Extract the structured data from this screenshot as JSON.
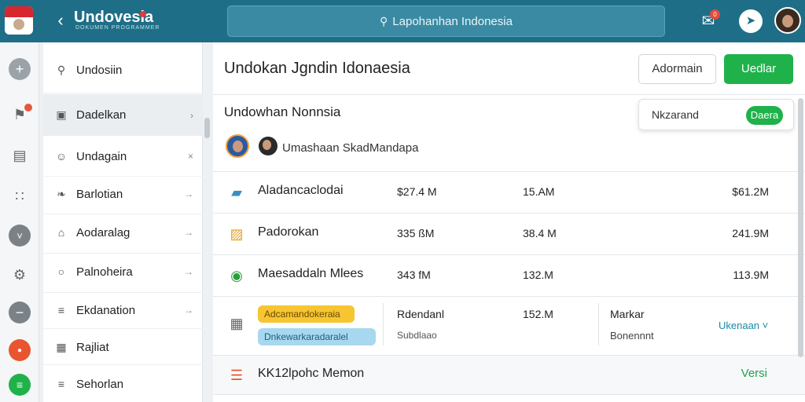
{
  "app": {
    "brand_name": "Undovesia",
    "brand_tagline": "DOKUMEN PROGRAMMER",
    "search_text": "Lapohan­han Indonesia",
    "notification_count": "0"
  },
  "sidebar": {
    "items": [
      {
        "label": "Undosiin",
        "icon": "search-icon",
        "glyph": "⚲",
        "trailing": ""
      },
      {
        "label": "Dadelkan",
        "icon": "image-icon",
        "glyph": "▣",
        "trailing": "›"
      },
      {
        "label": "Undagain",
        "icon": "user-icon",
        "glyph": "☺",
        "trailing": "×"
      },
      {
        "label": "Barlotian",
        "icon": "bird-icon",
        "glyph": "❧",
        "trailing": "→"
      },
      {
        "label": "Aodaralag",
        "icon": "home-icon",
        "glyph": "⌂",
        "trailing": "→"
      },
      {
        "label": "Palnoheira",
        "icon": "chat-icon",
        "glyph": "○",
        "trailing": "→"
      },
      {
        "label": "Ekdanation",
        "icon": "document-icon",
        "glyph": "≡",
        "trailing": "→"
      },
      {
        "label": "Rajliat",
        "icon": "calendar-icon",
        "glyph": "▦",
        "trailing": ""
      },
      {
        "label": "Sehorlan",
        "icon": "list-icon",
        "glyph": "≡",
        "trailing": ""
      }
    ]
  },
  "main": {
    "page_title": "Undokan Jgndin Idonaesia",
    "button_secondary": "Adormain",
    "button_primary": "Uedlar",
    "section_title": "Undowhan Nonnsia",
    "float_card_label": "Nkzarand",
    "float_card_pill": "Daera",
    "members_label": "Umashaan SkadMandapa",
    "rows": [
      {
        "name": "Aladancaclodai",
        "icon": "folder-icon",
        "glyph": "▰",
        "c1": "$27.4 M",
        "c2": "15.AM",
        "c3": "$61.2M"
      },
      {
        "name": "Padorokan",
        "icon": "folder-open-icon",
        "glyph": "▨",
        "c1": "335 ßM",
        "c2": "38.4 M",
        "c3": "241.9M"
      },
      {
        "name": "Maesaddaln Mlees",
        "icon": "location-icon",
        "glyph": "◉",
        "c1": "343 fM",
        "c2": "132.M",
        "c3": "113.9M"
      }
    ],
    "detail_row": {
      "tag_yellow": "Adcamandokeraia",
      "tag_blue": "Dnkewarkaradaralel",
      "col_a_title": "Rdendanl",
      "col_a_sub": "Subdlaao",
      "col_b": "152.M",
      "col_c_title": "Markar",
      "col_c_sub": "Bonennnt",
      "link": "Ukenaan ˅"
    },
    "last_row": {
      "name": "KK12lpohc Memon",
      "action": "Versi"
    }
  }
}
